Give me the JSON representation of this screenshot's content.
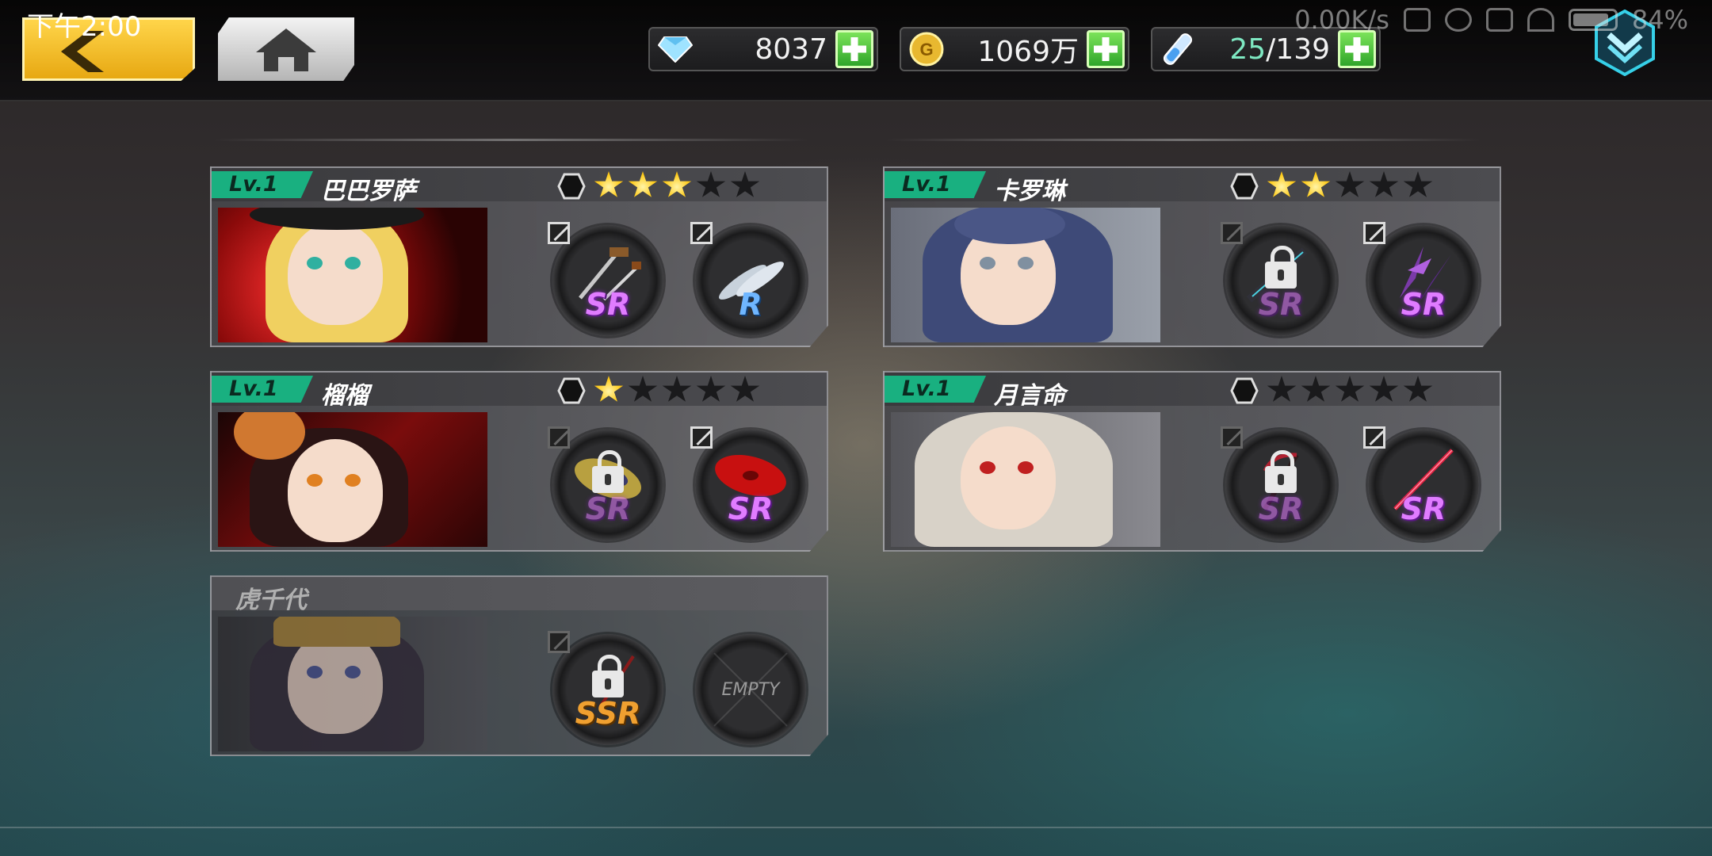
{
  "status_bar": {
    "time": "下午2:00",
    "net_speed": "0.00K/s",
    "battery": "84%"
  },
  "nav": {
    "back_icon": "back-chevron-icon",
    "home_icon": "home-icon",
    "menu_icon": "chevron-down-shield-icon"
  },
  "resources": {
    "diamonds": {
      "icon": "diamond-icon",
      "value": "8037"
    },
    "gold": {
      "icon": "gold-coin-icon",
      "value": "1069万"
    },
    "stamina": {
      "icon": "stamina-vial-icon",
      "current": "25",
      "max": "/139"
    }
  },
  "characters": [
    {
      "level": "Lv.1",
      "name": "巴巴罗萨",
      "stars_on": 3,
      "stars_total": 5,
      "slots": [
        {
          "rarity": "SR",
          "locked": false,
          "weapon": "pistol-sword"
        },
        {
          "rarity": "R",
          "locked": false,
          "weapon": "fish"
        }
      ]
    },
    {
      "level": "Lv.1",
      "name": "卡罗琳",
      "stars_on": 2,
      "stars_total": 5,
      "slots": [
        {
          "rarity": "SR",
          "locked": true,
          "weapon": "dark-blade"
        },
        {
          "rarity": "SR",
          "locked": false,
          "weapon": "purple-claws"
        }
      ]
    },
    {
      "level": "Lv.1",
      "name": "榴榴",
      "stars_on": 1,
      "stars_total": 5,
      "slots": [
        {
          "rarity": "SR",
          "locked": true,
          "weapon": "straw-hat"
        },
        {
          "rarity": "SR",
          "locked": false,
          "weapon": "red-umbrella"
        }
      ]
    },
    {
      "level": "Lv.1",
      "name": "月言命",
      "stars_on": 0,
      "stars_total": 5,
      "slots": [
        {
          "rarity": "SR",
          "locked": true,
          "weapon": "scythe"
        },
        {
          "rarity": "SR",
          "locked": false,
          "weapon": "red-spear"
        }
      ]
    },
    {
      "level": "",
      "name": "虎千代",
      "stars_on": 0,
      "stars_total": 0,
      "slots": [
        {
          "rarity": "SSR",
          "locked": true,
          "weapon": "katana"
        },
        {
          "rarity": "",
          "locked": false,
          "empty_label": "EMPTY"
        }
      ]
    }
  ],
  "colors": {
    "accent_green": "#19b080",
    "star_gold": "#ffcc1a",
    "sr_purple": "#e07cff",
    "r_blue": "#6fb6ff",
    "ssr_orange": "#f0a030"
  }
}
